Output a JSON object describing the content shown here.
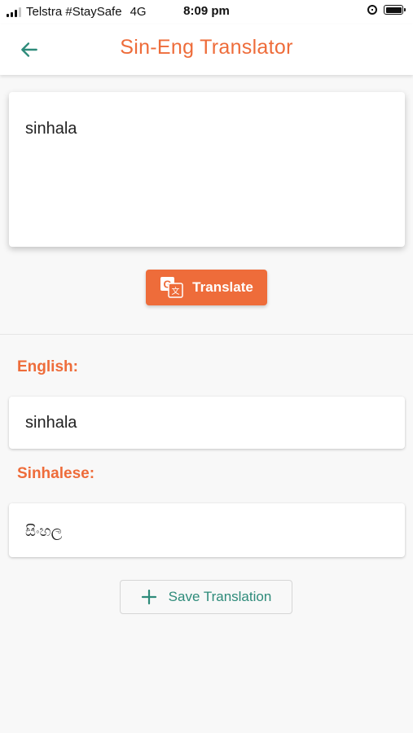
{
  "status_bar": {
    "carrier": "Telstra #StaySafe",
    "network": "4G",
    "time": "8:09 pm",
    "icons": [
      "signal-icon",
      "orientation-lock-icon",
      "battery-icon"
    ]
  },
  "app_bar": {
    "title": "Sin-Eng Translator",
    "back_icon": "arrow-left-icon"
  },
  "input": {
    "value": "sinhala"
  },
  "translate_button": {
    "label": "Translate",
    "icon": "google-translate-icon"
  },
  "results": {
    "english_label": "English:",
    "english_value": "sinhala",
    "sinhalese_label": "Sinhalese:",
    "sinhalese_value": "සිංහල"
  },
  "save_button": {
    "label": "Save Translation",
    "icon": "plus-icon"
  },
  "colors": {
    "accent": "#ee6c3a",
    "teal": "#2e8b7a",
    "background": "#f8f8f8"
  }
}
